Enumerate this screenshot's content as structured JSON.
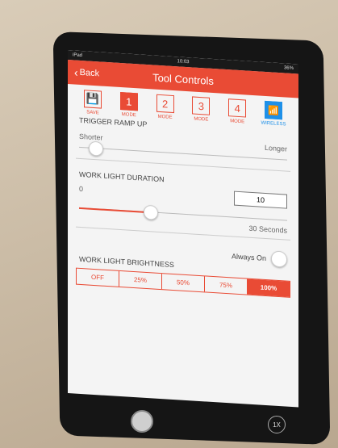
{
  "status_bar": {
    "left": "iPad",
    "center": "10:03",
    "right": "36%"
  },
  "nav": {
    "back_label": "Back",
    "title": "Tool Controls"
  },
  "modes": [
    {
      "icon": "save-icon",
      "value": "💾",
      "label": "SAVE"
    },
    {
      "value": "1",
      "label": "MODE",
      "active": true
    },
    {
      "value": "2",
      "label": "MODE"
    },
    {
      "value": "3",
      "label": "MODE"
    },
    {
      "value": "4",
      "label": "MODE"
    },
    {
      "icon": "wifi-icon",
      "value": "📶",
      "label": "WIRELESS"
    }
  ],
  "trigger_ramp": {
    "label": "TRIGGER RAMP UP",
    "min_label": "Shorter",
    "max_label": "Longer",
    "level": 0.05
  },
  "work_light_duration": {
    "label": "WORK LIGHT DURATION",
    "min_value": "0",
    "current_value": "10",
    "max_label": "30 Seconds",
    "level": 0.33
  },
  "always_on": {
    "label": "Always On"
  },
  "work_light_brightness": {
    "label": "WORK LIGHT BRIGHTNESS",
    "options": [
      "OFF",
      "25%",
      "50%",
      "75%",
      "100%"
    ],
    "selected": "100%"
  },
  "zoom_badge": "1X",
  "colors": {
    "accent": "#e94b35",
    "wireless": "#1e90e8"
  }
}
